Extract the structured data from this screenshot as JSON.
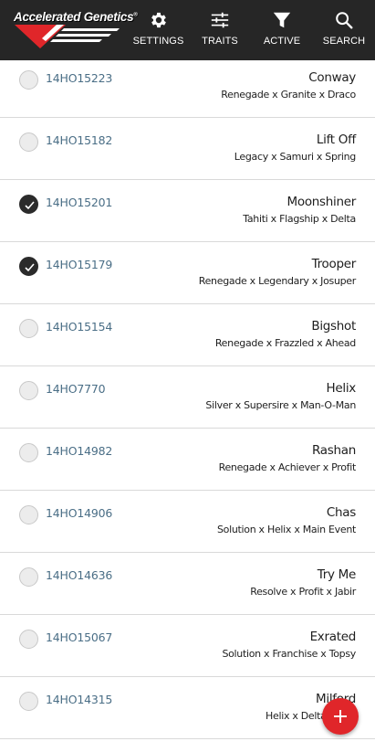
{
  "app": {
    "logo_text": "Accelerated Genetics",
    "logo_reg": "®",
    "brand_color": "#e0262a"
  },
  "nav": [
    {
      "label": "SETTINGS",
      "icon": "gear-icon"
    },
    {
      "label": "TRAITS",
      "icon": "sliders-icon"
    },
    {
      "label": "ACTIVE",
      "icon": "filter-icon"
    },
    {
      "label": "SEARCH",
      "icon": "search-icon"
    }
  ],
  "bulls": [
    {
      "code": "14HO15223",
      "name": "Conway",
      "pedigree": "Renegade x Granite x Draco",
      "selected": false
    },
    {
      "code": "14HO15182",
      "name": "Lift Off",
      "pedigree": "Legacy x Samuri x Spring",
      "selected": false
    },
    {
      "code": "14HO15201",
      "name": "Moonshiner",
      "pedigree": "Tahiti x Flagship x Delta",
      "selected": true
    },
    {
      "code": "14HO15179",
      "name": "Trooper",
      "pedigree": "Renegade x Legendary x Josuper",
      "selected": true
    },
    {
      "code": "14HO15154",
      "name": "Bigshot",
      "pedigree": "Renegade x Frazzled x Ahead",
      "selected": false
    },
    {
      "code": "14HO7770",
      "name": "Helix",
      "pedigree": "Silver x Supersire x Man-O-Man",
      "selected": false
    },
    {
      "code": "14HO14982",
      "name": "Rashan",
      "pedigree": "Renegade x Achiever x Profit",
      "selected": false
    },
    {
      "code": "14HO14906",
      "name": "Chas",
      "pedigree": "Solution x Helix x Main Event",
      "selected": false
    },
    {
      "code": "14HO14636",
      "name": "Try Me",
      "pedigree": "Resolve x Profit x Jabir",
      "selected": false
    },
    {
      "code": "14HO15067",
      "name": "Exrated",
      "pedigree": "Solution x Franchise x Topsy",
      "selected": false
    },
    {
      "code": "14HO14315",
      "name": "Milford",
      "pedigree": "Helix x Delta x Sno",
      "selected": false
    }
  ],
  "fab": {
    "icon": "plus-icon"
  }
}
